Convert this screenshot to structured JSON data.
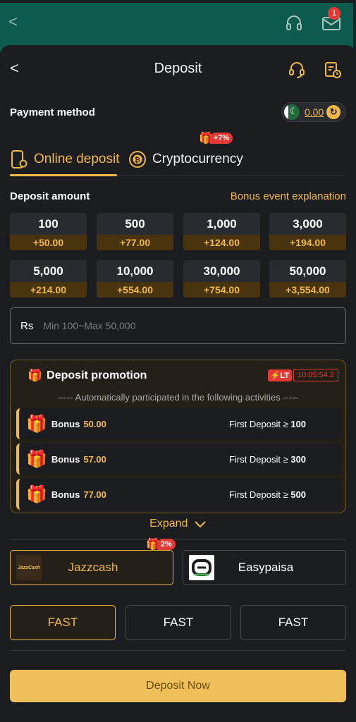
{
  "background": {
    "mail_badge": "1"
  },
  "header": {
    "title": "Deposit"
  },
  "payment_method": {
    "label": "Payment method",
    "balance": "0.00"
  },
  "tabs": [
    {
      "label": "Online deposit",
      "active": true
    },
    {
      "label": "Cryptocurrency",
      "active": false,
      "tag": "+7%"
    }
  ],
  "deposit_amount": {
    "label": "Deposit amount",
    "bonus_link": "Bonus event explanation",
    "options": [
      {
        "amount": "100",
        "bonus": "+50.00"
      },
      {
        "amount": "500",
        "bonus": "+77.00"
      },
      {
        "amount": "1,000",
        "bonus": "+124.00"
      },
      {
        "amount": "3,000",
        "bonus": "+194.00"
      },
      {
        "amount": "5,000",
        "bonus": "+214.00"
      },
      {
        "amount": "10,000",
        "bonus": "+554.00"
      },
      {
        "amount": "30,000",
        "bonus": "+754.00"
      },
      {
        "amount": "50,000",
        "bonus": "+3,554.00"
      }
    ]
  },
  "amount_input": {
    "prefix": "Rs",
    "placeholder": "Min 100~Max 50,000",
    "value": ""
  },
  "promotion": {
    "title": "Deposit promotion",
    "lt_badge": "LT",
    "timer": "10:05:54.2",
    "subtitle": "----- Automatically participated in the following activities -----",
    "rows": [
      {
        "label": "Bonus",
        "value": "50.00",
        "condition": "First Deposit ≥",
        "threshold": "100"
      },
      {
        "label": "Bonus",
        "value": "57.00",
        "condition": "First Deposit ≥",
        "threshold": "300"
      },
      {
        "label": "Bonus",
        "value": "77.00",
        "condition": "First Deposit ≥",
        "threshold": "500"
      }
    ],
    "expand_label": "Expand"
  },
  "channels": [
    {
      "name": "Jazzcash",
      "selected": true,
      "tag": "2%",
      "logo_text": "JazzCash"
    },
    {
      "name": "Easypaisa",
      "selected": false
    }
  ],
  "speed_options": [
    {
      "label": "FAST",
      "selected": true
    },
    {
      "label": "FAST",
      "selected": false
    },
    {
      "label": "FAST",
      "selected": false
    }
  ],
  "submit": {
    "label": "Deposit Now"
  },
  "colors": {
    "accent": "#f0b945",
    "sheet_bg": "#1c1d21",
    "alert_red": "#e53935",
    "bg_header": "#0d5b4f"
  }
}
